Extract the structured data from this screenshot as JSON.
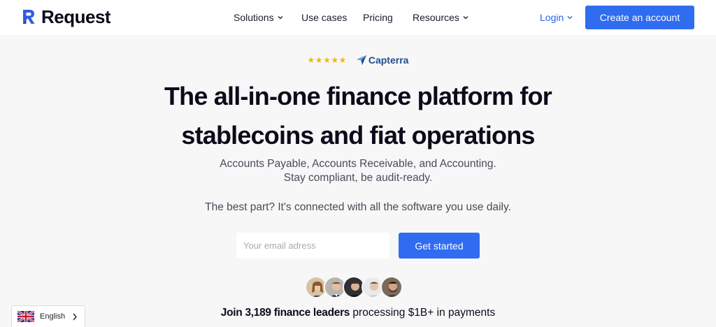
{
  "brand": {
    "name": "Request"
  },
  "nav": {
    "items": [
      {
        "label": "Solutions",
        "dropdown": true
      },
      {
        "label": "Use cases",
        "dropdown": false
      },
      {
        "label": "Pricing",
        "dropdown": false
      },
      {
        "label": "Resources",
        "dropdown": true
      }
    ],
    "login": "Login",
    "cta": "Create an account"
  },
  "rating": {
    "stars": "★★★★★",
    "provider": "Capterra"
  },
  "hero": {
    "headline_line1": "The all-in-one finance platform for",
    "headline_line2": "stablecoins and fiat operations",
    "sub_line1": "Accounts Payable, Accounts Receivable, and Accounting.",
    "sub_line2": "Stay compliant, be audit-ready.",
    "best_part": "The best part? It's connected with all the software you use daily."
  },
  "signup": {
    "email_placeholder": "Your email adress",
    "button": "Get started"
  },
  "social_proof": {
    "join_bold": "Join 3,189 finance leaders",
    "join_rest": " processing $1B+ in payments"
  },
  "language": {
    "label": "English"
  },
  "colors": {
    "accent": "#2f6cf0",
    "star": "#f5b700",
    "capterra": "#1f4f8a"
  }
}
